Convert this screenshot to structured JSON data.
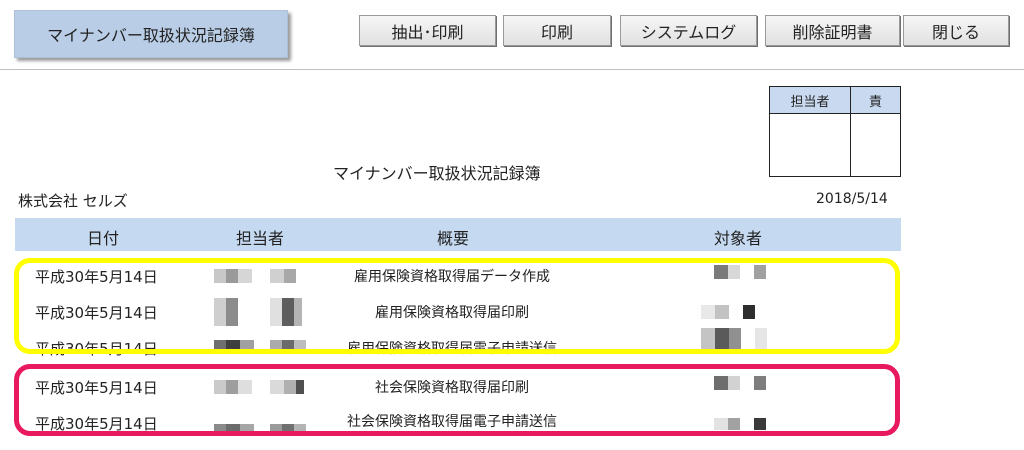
{
  "app": {
    "title": "マイナンバー取扱状況記録簿"
  },
  "toolbar": {
    "extract_print": "抽出･印刷",
    "print": "印刷",
    "system_log": "システムログ",
    "deletion_certificate": "削除証明書",
    "close": "閉じる"
  },
  "signature": {
    "person_label": "担当者",
    "responsible_label": "責"
  },
  "document": {
    "title": "マイナンバー取扱状況記録簿",
    "company": "株式会社 セルズ",
    "date": "2018/5/14"
  },
  "table": {
    "headers": {
      "date": "日付",
      "person": "担当者",
      "summary": "概要",
      "subject": "対象者"
    },
    "rows": [
      {
        "date": "平成30年5月14日",
        "summary": "雇用保険資格取得届データ作成"
      },
      {
        "date": "平成30年5月14日",
        "summary": "雇用保険資格取得届印刷"
      },
      {
        "date": "平成30年5月14日",
        "summary": "雇用保険資格取得届電子申請送信"
      },
      {
        "date": "平成30年5月14日",
        "summary": "社会保険資格取得届印刷"
      },
      {
        "date": "平成30年5月14日",
        "summary": "社会保険資格取得届電子申請送信"
      }
    ]
  },
  "colors": {
    "title_bg": "#b9cde6",
    "header_bg": "#c5d9f1",
    "highlight_yellow": "#ffff00",
    "highlight_magenta": "#e8195f"
  }
}
